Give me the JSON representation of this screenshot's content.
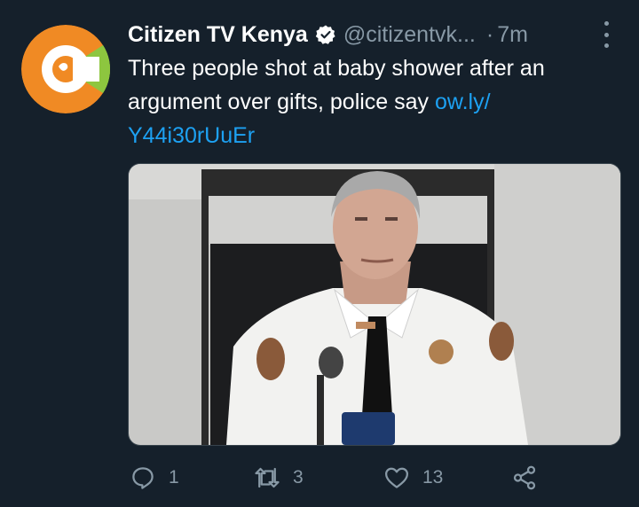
{
  "tweet": {
    "display_name": "Citizen TV Kenya",
    "handle": "@citizentvk...",
    "separator": "·",
    "time": "7m",
    "text": "Three people shot at baby shower after an argument over gifts, police say ",
    "link_line1": "ow.ly/",
    "link_line2": "Y44i30rUuEr"
  },
  "actions": {
    "reply_count": "1",
    "retweet_count": "3",
    "like_count": "13"
  },
  "colors": {
    "background": "#15202b",
    "link": "#1da1f2",
    "secondary_text": "#8899a6",
    "logo_orange": "#f08a24",
    "logo_green": "#8dc63f"
  },
  "icons": [
    "verified-badge-icon",
    "more-options-icon",
    "reply-icon",
    "retweet-icon",
    "like-icon",
    "share-icon"
  ]
}
